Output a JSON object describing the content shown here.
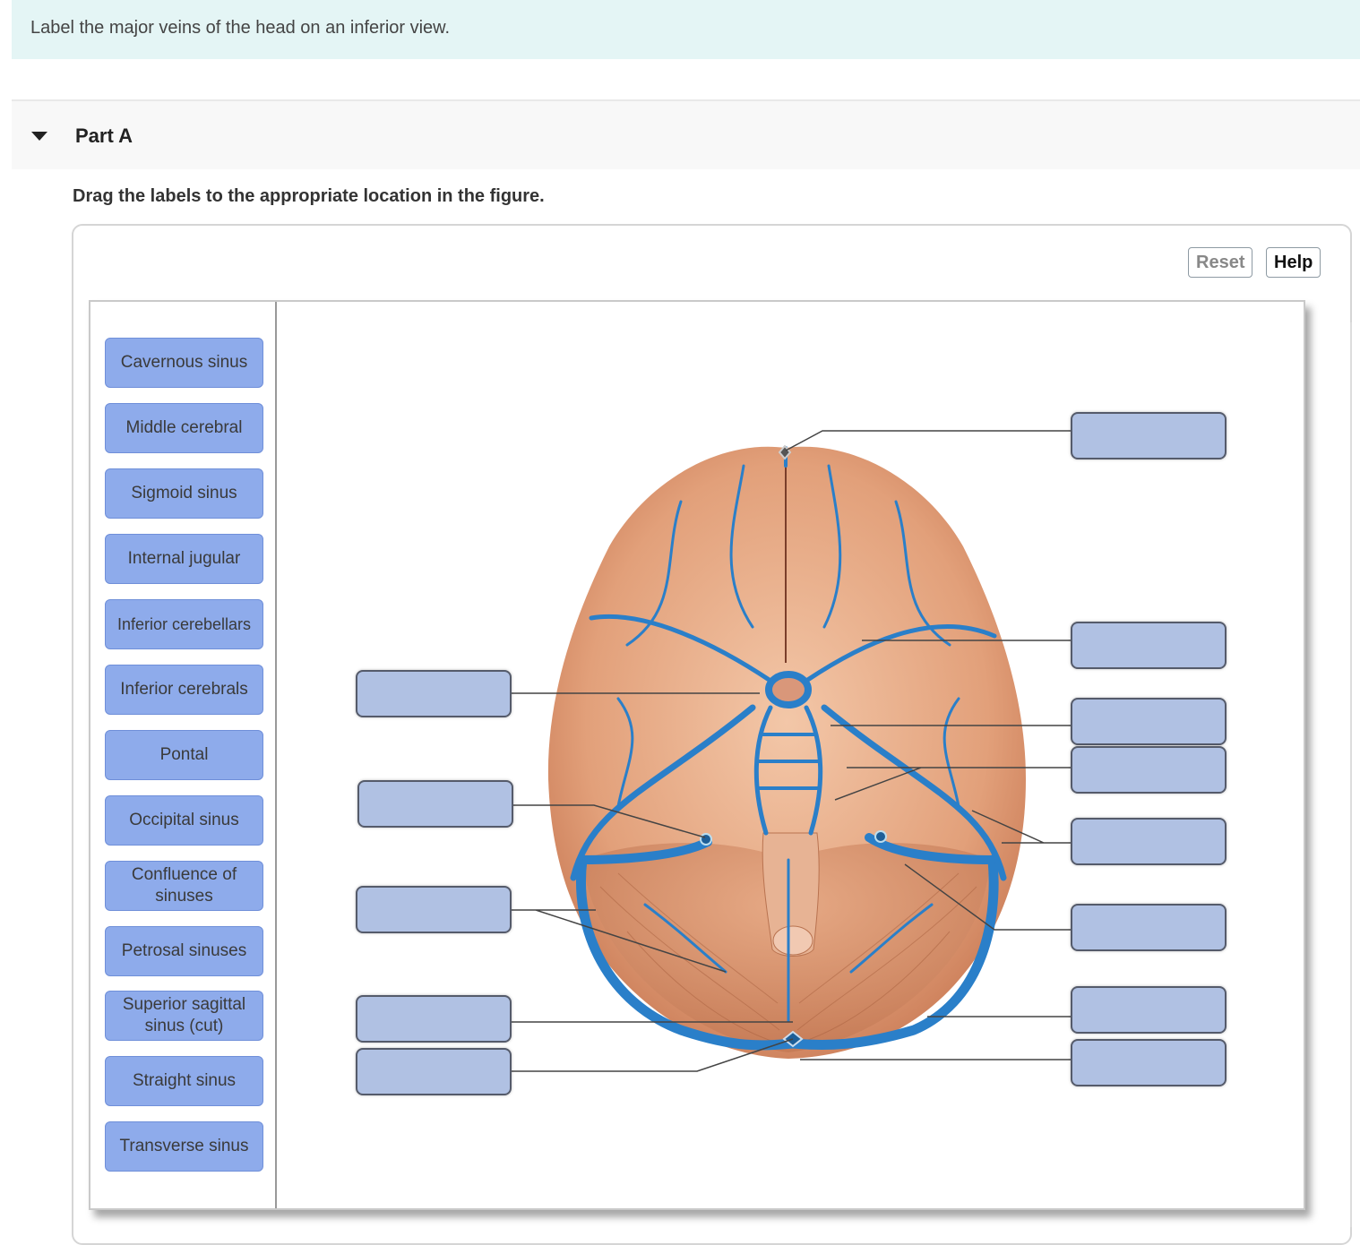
{
  "intro": {
    "text": "Label the major veins of the head on an inferior view."
  },
  "part": {
    "title": "Part A",
    "caret_icon": "caret-down-icon",
    "expanded": true
  },
  "instruction": "Drag the labels to the appropriate location in the figure.",
  "toolbar": {
    "reset_label": "Reset",
    "help_label": "Help",
    "reset_enabled": false
  },
  "label_bank": [
    "Cavernous sinus",
    "Middle cerebral",
    "Sigmoid sinus",
    "Internal jugular",
    "Inferior cerebellars",
    "Inferior cerebrals",
    "Pontal",
    "Occipital sinus",
    "Confluence of sinuses",
    "Petrosal sinuses",
    "Superior sagittal sinus (cut)",
    "Straight sinus",
    "Transverse sinus"
  ],
  "figure": {
    "description": "Inferior view of the brain showing major veins and dural sinuses",
    "colors": {
      "vein": "#2a7fc9",
      "tissue": "#e3a07c",
      "drop_target": "#b0c1e3",
      "chip": "#8eabeb"
    },
    "drop_targets": {
      "left": [
        "",
        "",
        "",
        "",
        ""
      ],
      "right": [
        "",
        "",
        "",
        "",
        "",
        "",
        "",
        ""
      ]
    }
  }
}
